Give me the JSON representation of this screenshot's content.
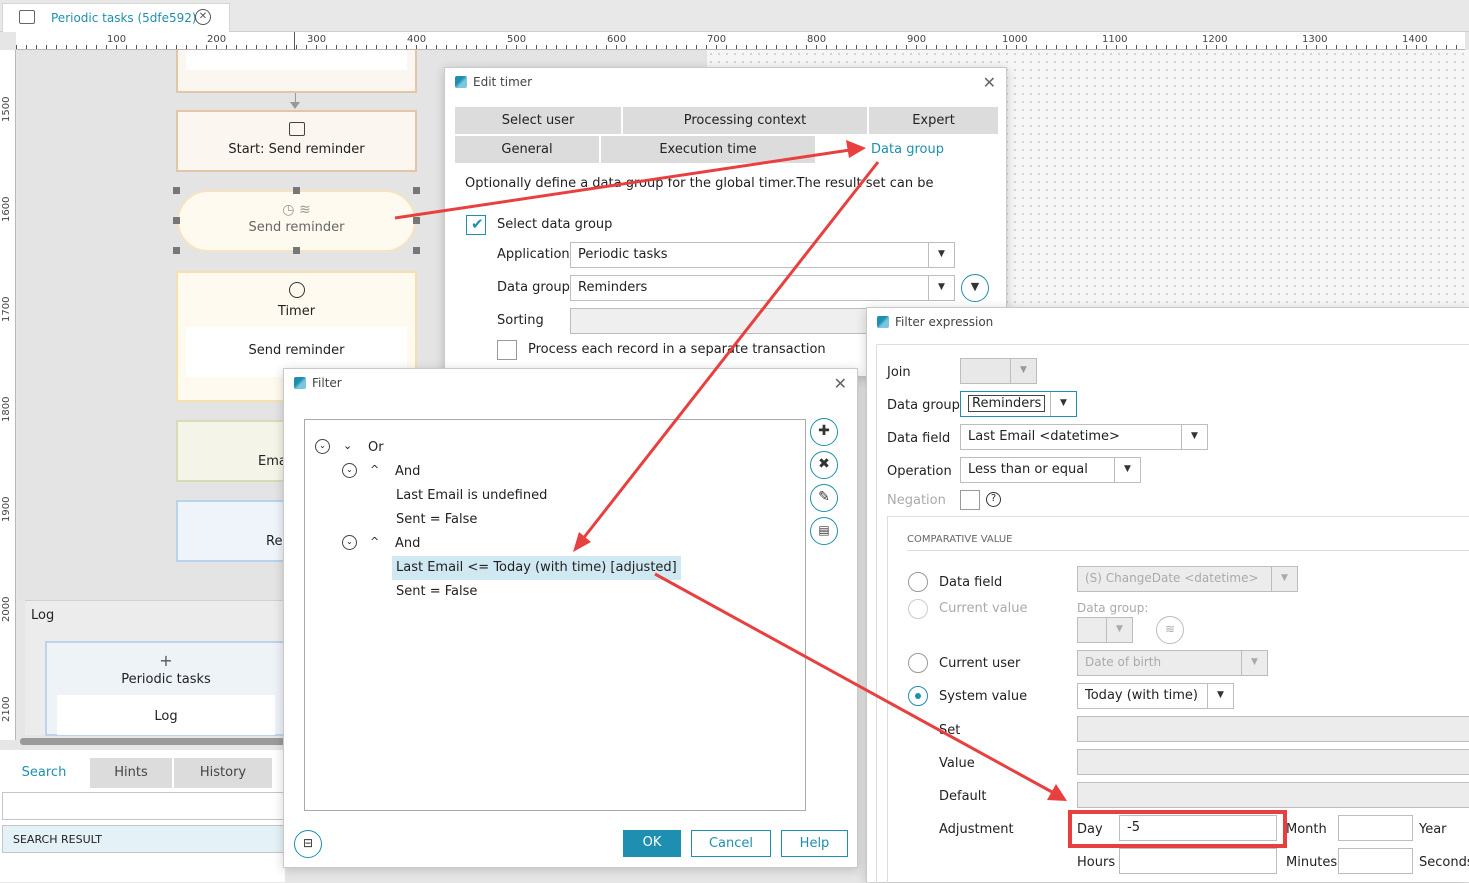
{
  "app": {
    "tab_title": "Periodic tasks (5dfe592)"
  },
  "ruler": {
    "h": [
      "100",
      "200",
      "300",
      "400",
      "500",
      "600",
      "700",
      "800",
      "900",
      "1000",
      "1100",
      "1200",
      "1300",
      "1400"
    ],
    "v": [
      "1500",
      "1600",
      "1700",
      "1800",
      "1900",
      "2000",
      "2100"
    ]
  },
  "flow": {
    "node1": "Start: Send reminder",
    "node2": "Send reminder",
    "node3_title": "Timer",
    "node3_sub": "Send reminder",
    "node4": "Ema",
    "node5": "Re"
  },
  "log": {
    "title": "Log",
    "card_title": "Periodic tasks",
    "card_sub": "Log"
  },
  "bottom": {
    "tabs": [
      "Search",
      "Hints",
      "History"
    ],
    "result_header": "SEARCH RESULT"
  },
  "edit_timer": {
    "title": "Edit timer",
    "tabs_row1": [
      "Select user",
      "Processing context",
      "Expert"
    ],
    "tabs_row2": [
      "General",
      "Execution time",
      "Data group"
    ],
    "description": "Optionally define a data group for the global timer.The result set can be restricted with a filter.",
    "select_label": "Select data group",
    "application_label": "Application",
    "application_value": "Periodic tasks",
    "data_group_label": "Data group",
    "data_group_value": "Reminders",
    "sorting_label": "Sorting",
    "process_label": "Process each record in a separate transaction"
  },
  "filter": {
    "title": "Filter",
    "tree": [
      "Or",
      "And",
      "Last Email is undefined",
      "Sent = False",
      "And",
      "Last Email <= Today (with time) [adjusted]",
      "Sent = False"
    ],
    "ok": "OK",
    "cancel": "Cancel",
    "help": "Help"
  },
  "filter_expr": {
    "title": "Filter expression",
    "join_label": "Join",
    "data_group_label": "Data group",
    "data_group_value": "Reminders",
    "data_field_label": "Data field",
    "data_field_value": "Last Email <datetime>",
    "operation_label": "Operation",
    "operation_value": "Less than or equal",
    "negation_label": "Negation",
    "comparative_header": "COMPARATIVE VALUE",
    "opt_data_field": "Data field",
    "opt_data_field_value": "(S) ChangeDate <datetime>",
    "opt_current_value": "Current value",
    "dg_small_label": "Data group:",
    "opt_current_user": "Current user",
    "opt_current_user_value": "Date of birth",
    "opt_system_value": "System value",
    "system_value_value": "Today (with time)",
    "set_label": "Set",
    "value_label": "Value",
    "default_label": "Default",
    "adjustment_label": "Adjustment",
    "day_label": "Day",
    "day_value": "-5",
    "month_label": "Month",
    "year_label": "Year",
    "hours_label": "Hours",
    "minutes_label": "Minutes",
    "seconds_label": "Seconds"
  },
  "colors": {
    "accent": "#1e8fb0",
    "highlight": "#e83f3f",
    "selected_row": "#cfe8f1"
  }
}
